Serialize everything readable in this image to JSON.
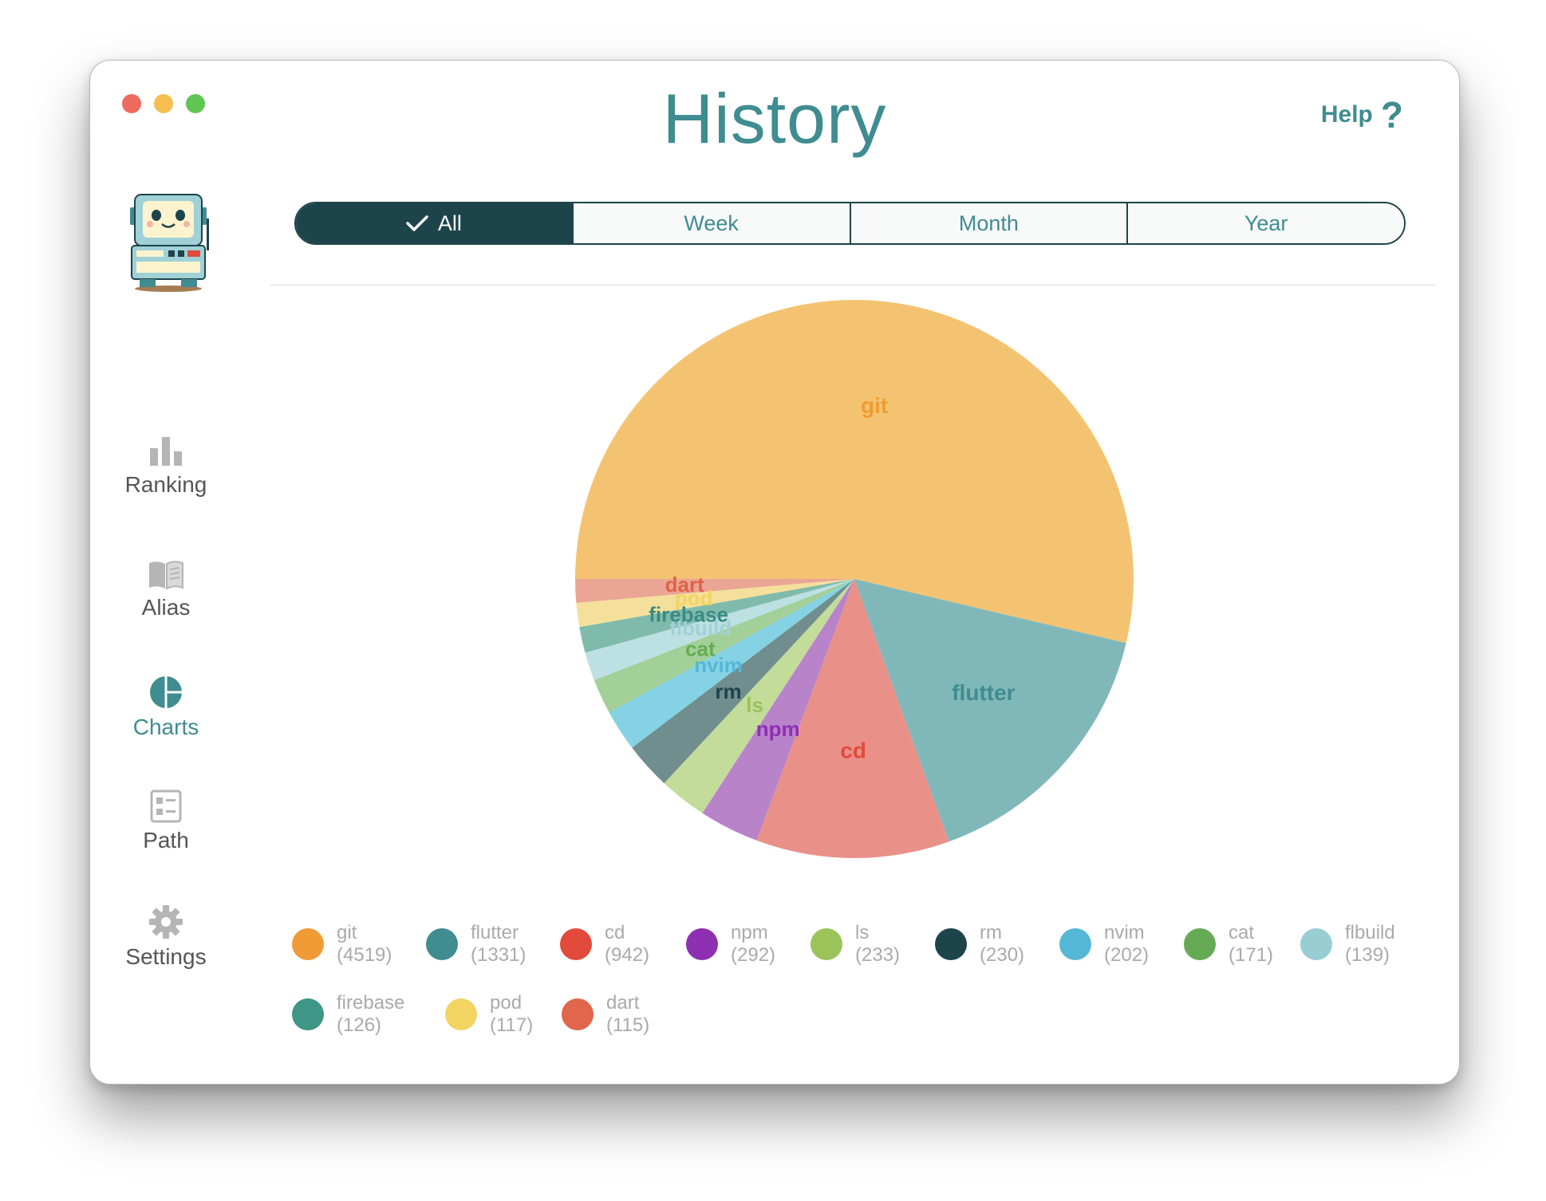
{
  "window": {
    "title": "History",
    "help_label": "Help",
    "help_symbol": "?"
  },
  "sidebar": {
    "items": [
      {
        "label": "Ranking",
        "icon": "bar-chart-icon"
      },
      {
        "label": "Alias",
        "icon": "book-icon"
      },
      {
        "label": "Charts",
        "icon": "pie-chart-icon",
        "active": true
      },
      {
        "label": "Path",
        "icon": "path-list-icon"
      },
      {
        "label": "Settings",
        "icon": "gear-icon"
      }
    ]
  },
  "filters": {
    "options": [
      "All",
      "Week",
      "Month",
      "Year"
    ],
    "selected": "All"
  },
  "colors": {
    "accent": "#3f8c91",
    "dark": "#1e444b"
  },
  "chart_data": {
    "type": "pie",
    "title": "",
    "series": [
      {
        "label": "git",
        "value": 4519,
        "legend": "(4519)",
        "slice_color": "#f4c372",
        "label_color": "#f09b35",
        "legend_color": "#f09b35"
      },
      {
        "label": "flutter",
        "value": 1331,
        "legend": "(1331)",
        "slice_color": "#80b8ba",
        "label_color": "#3f8c91",
        "legend_color": "#3f8c91"
      },
      {
        "label": "cd",
        "value": 942,
        "legend": "(942)",
        "slice_color": "#e99189",
        "label_color": "#e24a3b",
        "legend_color": "#e24a3b"
      },
      {
        "label": "npm",
        "value": 292,
        "legend": "(292)",
        "slice_color": "#b983ca",
        "label_color": "#8e2fb1",
        "legend_color": "#8e2fb1"
      },
      {
        "label": "ls",
        "value": 233,
        "legend": "(233)",
        "slice_color": "#c3dc9a",
        "label_color": "#9ac35a",
        "legend_color": "#9ac35a"
      },
      {
        "label": "rm",
        "value": 230,
        "legend": "(230)",
        "slice_color": "#6f8e8d",
        "label_color": "#1e444b",
        "legend_color": "#1e444b"
      },
      {
        "label": "nvim",
        "value": 202,
        "legend": "(202)",
        "slice_color": "#84d2e3",
        "label_color": "#55b7d6",
        "legend_color": "#55b7d6"
      },
      {
        "label": "cat",
        "value": 171,
        "legend": "(171)",
        "slice_color": "#a3cf98",
        "label_color": "#65ab55",
        "legend_color": "#65ab55"
      },
      {
        "label": "flbuild",
        "value": 139,
        "legend": "(139)",
        "slice_color": "#bde0e3",
        "label_color": "#9fd1d6",
        "legend_color": "#98ced3"
      },
      {
        "label": "firebase",
        "value": 126,
        "legend": "(126)",
        "slice_color": "#7fbbab",
        "label_color": "#3b8b85",
        "legend_color": "#3e9686"
      },
      {
        "label": "pod",
        "value": 117,
        "legend": "(117)",
        "slice_color": "#f4e09a",
        "label_color": "#f1d462",
        "legend_color": "#f1d462"
      },
      {
        "label": "dart",
        "value": 115,
        "legend": "(115)",
        "slice_color": "#eba595",
        "label_color": "#e0624a",
        "legend_color": "#e0664c"
      }
    ]
  }
}
